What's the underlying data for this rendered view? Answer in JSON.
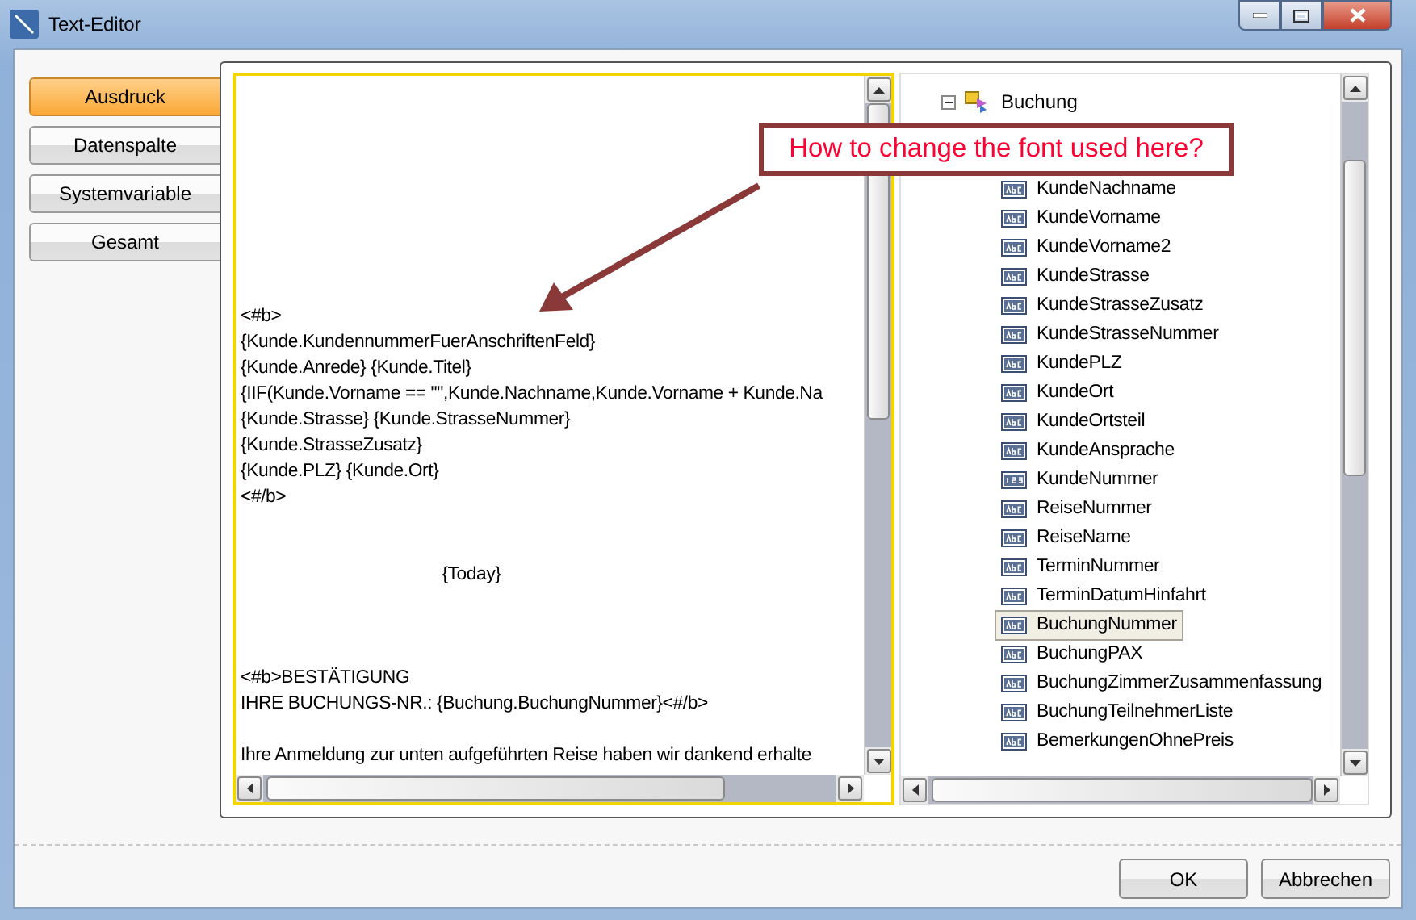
{
  "window": {
    "title": "Text-Editor"
  },
  "nav": [
    {
      "label": "Ausdruck",
      "selected": true
    },
    {
      "label": "Datenspalte",
      "selected": false
    },
    {
      "label": "Systemvariable",
      "selected": false
    },
    {
      "label": "Gesamt",
      "selected": false
    }
  ],
  "editor": {
    "blocks": [
      {
        "kind": "left",
        "lines": [
          "<#b>",
          "{Kunde.KundennummerFuerAnschriftenFeld}",
          "{Kunde.Anrede} {Kunde.Titel}",
          "{IIF(Kunde.Vorname == \"\",Kunde.Nachname,Kunde.Vorname + Kunde.Na",
          "{Kunde.Strasse} {Kunde.StrasseNummer}",
          "{Kunde.StrasseZusatz}",
          "{Kunde.PLZ} {Kunde.Ort}",
          "<#/b>"
        ]
      },
      {
        "kind": "center",
        "lines": [
          "{Today}"
        ]
      },
      {
        "kind": "left",
        "lines": [
          "<#b>BESTÄTIGUNG",
          "IHRE BUCHUNGS-NR.: {Buchung.BuchungNummer}<#/b>"
        ]
      },
      {
        "kind": "left",
        "lines": [
          "Ihre Anmeldung zur unten aufgeführten Reise haben wir dankend erhalte"
        ]
      }
    ]
  },
  "tree": {
    "label": "Buchung",
    "expanded": true,
    "children": [
      {
        "label": "KundeNachname",
        "kind": "text",
        "selected": false
      },
      {
        "label": "KundeVorname",
        "kind": "text",
        "selected": false
      },
      {
        "label": "KundeVorname2",
        "kind": "text",
        "selected": false
      },
      {
        "label": "KundeStrasse",
        "kind": "text",
        "selected": false
      },
      {
        "label": "KundeStrasseZusatz",
        "kind": "text",
        "selected": false
      },
      {
        "label": "KundeStrasseNummer",
        "kind": "text",
        "selected": false
      },
      {
        "label": "KundePLZ",
        "kind": "text",
        "selected": false
      },
      {
        "label": "KundeOrt",
        "kind": "text",
        "selected": false
      },
      {
        "label": "KundeOrtsteil",
        "kind": "text",
        "selected": false
      },
      {
        "label": "KundeAnsprache",
        "kind": "text",
        "selected": false
      },
      {
        "label": "KundeNummer",
        "kind": "number",
        "selected": false
      },
      {
        "label": "ReiseNummer",
        "kind": "text",
        "selected": false
      },
      {
        "label": "ReiseName",
        "kind": "text",
        "selected": false
      },
      {
        "label": "TerminNummer",
        "kind": "text",
        "selected": false
      },
      {
        "label": "TerminDatumHinfahrt",
        "kind": "text",
        "selected": false
      },
      {
        "label": "BuchungNummer",
        "kind": "text",
        "selected": true
      },
      {
        "label": "BuchungPAX",
        "kind": "text",
        "selected": false
      },
      {
        "label": "BuchungZimmerZusammenfassung",
        "kind": "text",
        "selected": false
      },
      {
        "label": "BuchungTeilnehmerListe",
        "kind": "text",
        "selected": false
      },
      {
        "label": "BemerkungenOhnePreis",
        "kind": "text",
        "selected": false
      }
    ]
  },
  "callout": {
    "text": "How to change the font used here?"
  },
  "buttons": [
    "OK",
    "Abbrechen"
  ]
}
